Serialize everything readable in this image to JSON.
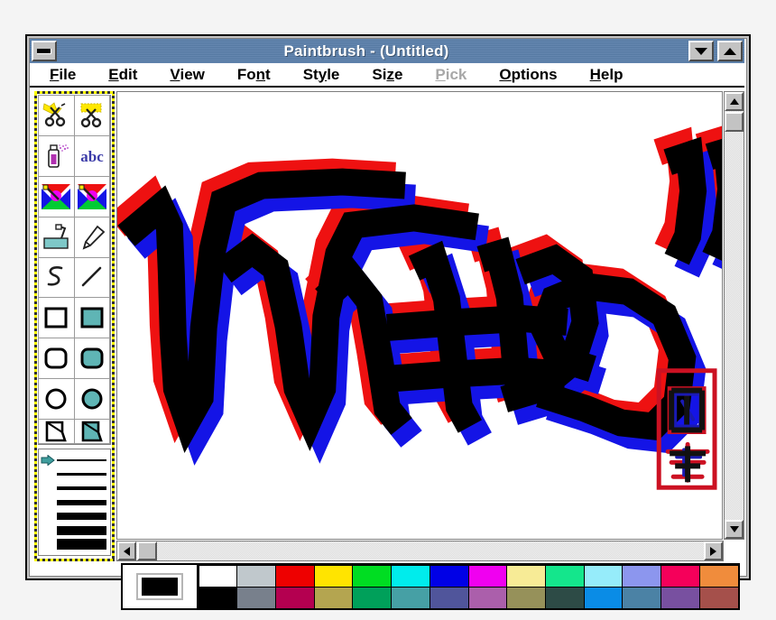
{
  "window": {
    "title": "Paintbrush - (Untitled)",
    "titlebar_color": "#5a7fab",
    "minimize_label": "Minimize",
    "restore_label": "Restore",
    "maximize_label": "Maximize"
  },
  "menu": {
    "items": [
      {
        "label": "File",
        "mnemonic": "F",
        "disabled": false
      },
      {
        "label": "Edit",
        "mnemonic": "E",
        "disabled": false
      },
      {
        "label": "View",
        "mnemonic": "V",
        "disabled": false
      },
      {
        "label": "Font",
        "mnemonic": "n",
        "disabled": false
      },
      {
        "label": "Style",
        "mnemonic": "y",
        "disabled": false
      },
      {
        "label": "Size",
        "mnemonic": "z",
        "disabled": false
      },
      {
        "label": "Pick",
        "mnemonic": "P",
        "disabled": true
      },
      {
        "label": "Options",
        "mnemonic": "O",
        "disabled": false
      },
      {
        "label": "Help",
        "mnemonic": "H",
        "disabled": false
      }
    ]
  },
  "toolbox": {
    "tools": [
      {
        "name": "scissors-freeform-select",
        "label": "Scissors (free-form cutout)"
      },
      {
        "name": "scissors-rectangle-select",
        "label": "Pick (rectangular cutout)"
      },
      {
        "name": "airbrush",
        "label": "Airbrush"
      },
      {
        "name": "text",
        "label": "Text"
      },
      {
        "name": "color-eraser",
        "label": "Color Eraser"
      },
      {
        "name": "eraser",
        "label": "Eraser"
      },
      {
        "name": "paint-roller",
        "label": "Paint Roller"
      },
      {
        "name": "brush",
        "label": "Brush"
      },
      {
        "name": "curve",
        "label": "Curve"
      },
      {
        "name": "line",
        "label": "Line"
      },
      {
        "name": "rectangle-outline",
        "label": "Box"
      },
      {
        "name": "rectangle-filled",
        "label": "Filled Box"
      },
      {
        "name": "rounded-rectangle-outline",
        "label": "Rounded Box"
      },
      {
        "name": "rounded-rectangle-filled",
        "label": "Filled Rounded Box"
      },
      {
        "name": "ellipse-outline",
        "label": "Circle/Ellipse"
      },
      {
        "name": "ellipse-filled",
        "label": "Filled Circle/Ellipse"
      },
      {
        "name": "polygon-outline",
        "label": "Polygon"
      },
      {
        "name": "polygon-filled",
        "label": "Filled Polygon"
      }
    ],
    "line_widths": {
      "label": "Line width selector",
      "selected_index": 0,
      "thicknesses": [
        2,
        3,
        4,
        6,
        8,
        10,
        12
      ]
    },
    "accent_color": "#3f9e9e"
  },
  "canvas": {
    "label": "Drawing canvas",
    "background": "#ffffff",
    "artwork": {
      "title": "Graffiti tag",
      "stroke_color": "#000000",
      "shadow_left_color": "#ee1111",
      "shadow_right_color": "#1414e6",
      "stamp": {
        "name": "signature-stamp",
        "border_color": "#cc1122",
        "glyph_colors": [
          "#111111",
          "#1a1ab4"
        ]
      }
    }
  },
  "scrollbars": {
    "vertical": {
      "name": "vertical-scrollbar",
      "thumb_position": "top",
      "up_label": "Scroll up",
      "down_label": "Scroll down"
    },
    "horizontal": {
      "name": "horizontal-scrollbar",
      "thumb_position": "left",
      "left_label": "Scroll left",
      "right_label": "Scroll right"
    }
  },
  "palette": {
    "current_foreground": "#000000",
    "current_background": "#ffffff",
    "row_top": [
      "#ffffff",
      "#c0c8cc",
      "#ee0000",
      "#ffe400",
      "#00dd22",
      "#00ecec",
      "#0000e6",
      "#f000f0",
      "#f7eb96",
      "#14e68c",
      "#96ecfa",
      "#8c96ee",
      "#f5005a",
      "#f08c3c"
    ],
    "row_bottom": [
      "#000000",
      "#78808c",
      "#b40050",
      "#b4a550",
      "#00a05a",
      "#46a0a5",
      "#50559b",
      "#ab5fab",
      "#96915a",
      "#2d4b46",
      "#0a8ce6",
      "#4b82a5",
      "#7850a0",
      "#a5504b"
    ]
  }
}
